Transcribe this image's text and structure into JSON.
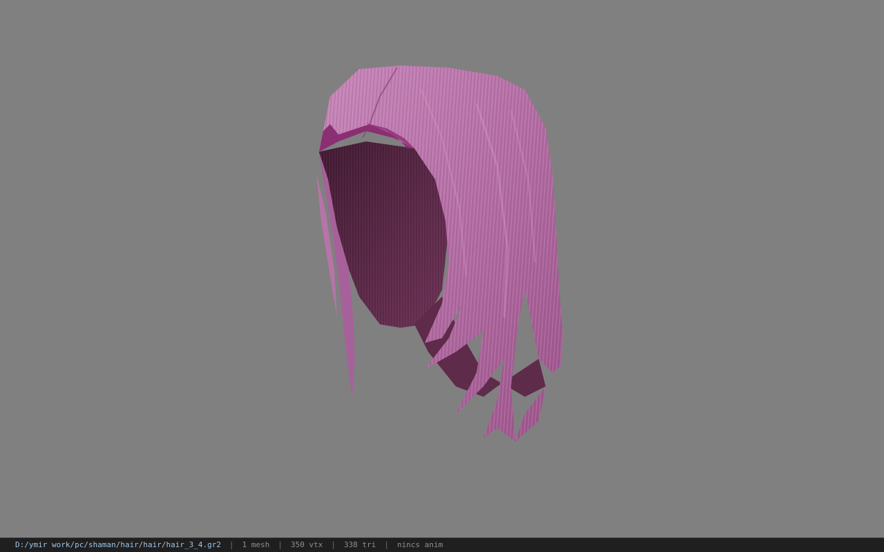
{
  "status_bar": {
    "file_path": "D:/ymir work/pc/shaman/hair/hair/hair_3_4.gr2",
    "separator": "|",
    "mesh_count": "1 mesh",
    "vertex_count": "350 vtx",
    "triangle_count": "338 tri",
    "animation": "nincs anim"
  },
  "viewport": {
    "background_color": "#808080",
    "model": "hair-mesh",
    "hair_color": "#b06aa0",
    "hair_shadow_color": "#4a2038"
  }
}
